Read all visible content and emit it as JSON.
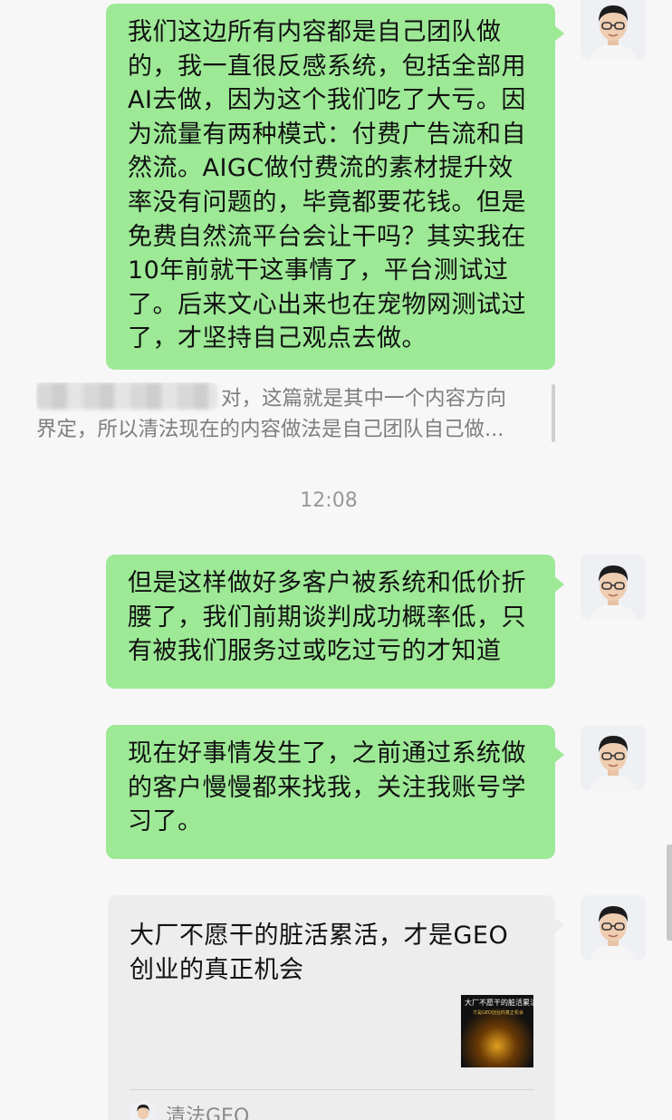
{
  "messages": [
    {
      "text": "我们这边所有内容都是自己团队做的，我一直很反感系统，包括全部用AI去做，因为这个我们吃了大亏。因为流量有两种模式：付费广告流和自然流。AIGC做付费流的素材提升效率没有问题的，毕竟都要花钱。但是免费自然流平台会让干吗？其实我在10年前就干这事情了，平台测试过了。后来文心出来也在宠物网测试过了，才坚持自己观点去做。"
    },
    {
      "text": "但是这样做好多客户被系统和低价折腰了，我们前期谈判成功概率低，只有被我们服务过或吃过亏的才知道"
    },
    {
      "text": "现在好事情发生了，之前通过系统做的客户慢慢都来找我，关注我账号学习了。"
    }
  ],
  "quote": {
    "line1": "对，这篇就是其中一个内容方向",
    "line2": "界定，所以清法现在的内容做法是自己团队自己做..."
  },
  "timestamp": "12:08",
  "card": {
    "title": "大厂不愿干的脏活累活，才是GEO创业的真正机会",
    "thumb_title": "大厂不愿干的脏活累活",
    "thumb_subtitle": "才是GEO创业的真正机会",
    "source_name": "清法GEO"
  },
  "colors": {
    "background": "#f7f7f7",
    "outgoing_bubble": "#9de996",
    "card_bubble": "#ededed",
    "timestamp": "#999999"
  }
}
